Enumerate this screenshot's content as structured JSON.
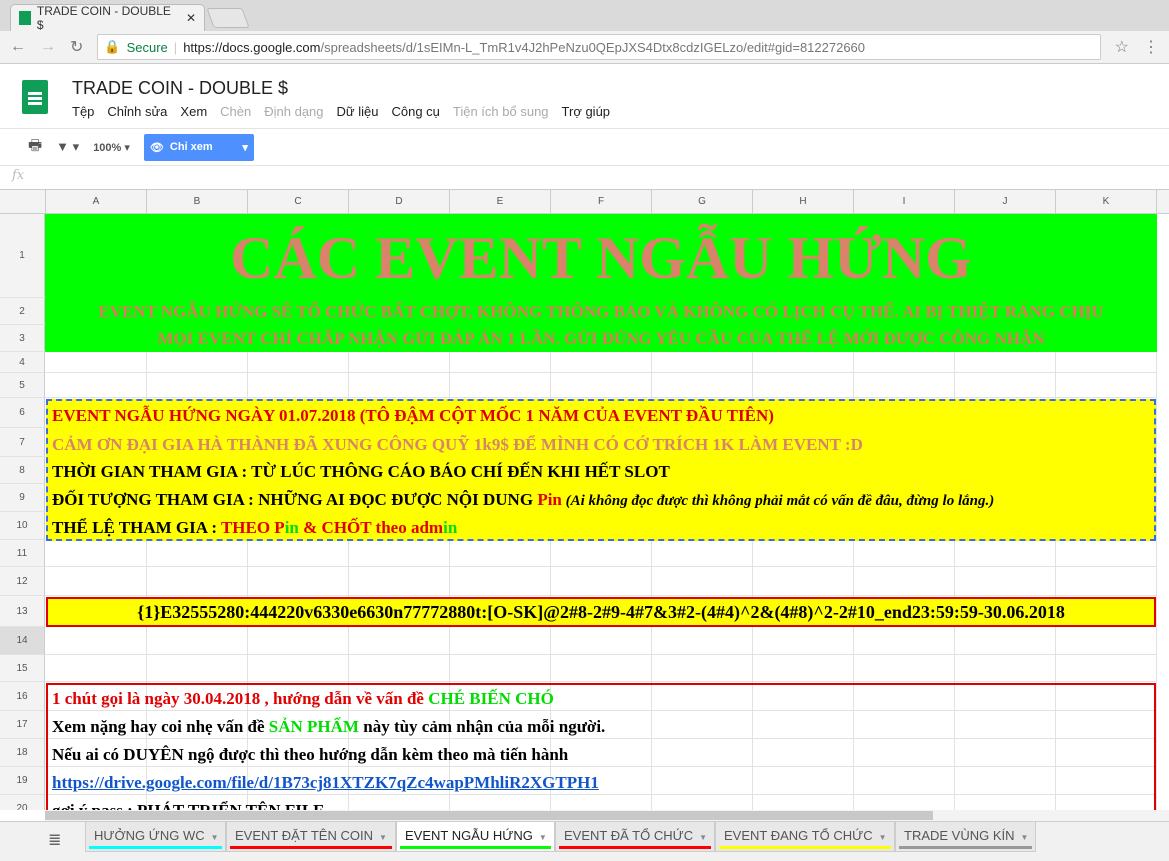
{
  "browser": {
    "tab_title": "TRADE COIN - DOUBLE $",
    "secure": "Secure",
    "url_host": "https://docs.google.com",
    "url_path": "/spreadsheets/d/1sEIMn-L_TmR1v4J2hPeNzu0QEpJXS4Dtx8cdzIGELzo/edit#gid=812272660"
  },
  "doc": {
    "title": "TRADE COIN - DOUBLE $",
    "menu": [
      "Tệp",
      "Chỉnh sửa",
      "Xem",
      "Chèn",
      "Định dạng",
      "Dữ liệu",
      "Công cụ",
      "Tiện ích bổ sung",
      "Trợ giúp"
    ]
  },
  "toolbar": {
    "zoom": "100%",
    "view_only": "Chỉ xem"
  },
  "formula_bar": {
    "fx": "fx"
  },
  "columns": [
    "A",
    "B",
    "C",
    "D",
    "E",
    "F",
    "G",
    "H",
    "I",
    "J",
    "K"
  ],
  "rows": [
    "1",
    "2",
    "3",
    "4",
    "5",
    "6",
    "7",
    "8",
    "9",
    "10",
    "11",
    "12",
    "13",
    "14",
    "15",
    "16",
    "17",
    "18",
    "19",
    "20"
  ],
  "banner": {
    "title": "CÁC EVENT NGẪU HỨNG",
    "line2": "EVENT NGẪU HỨNG SẼ TỔ CHỨC BẤT CHỢT, KHÔNG THÔNG BÁO VÀ KHÔNG CÓ LỊCH CỤ THỂ. AI BỊ THIỆT RÁNG CHỊU",
    "line3": "MỌI EVENT CHỈ CHẤP NHẬN GỬI ĐÁP ÁN 1 LẦN. GỬI ĐÚNG YÊU CẦU CỦA THỂ LỆ MỚI ĐƯỢC CÔNG NHẬN"
  },
  "event": {
    "r6": "EVENT NGẪU HỨNG NGÀY 01.07.2018 (TÔ ĐẬM CỘT MỐC 1 NĂM CỦA EVENT ĐẦU TIÊN)",
    "r7": "CẢM ƠN ĐẠI GIA HÀ THÀNH ĐÃ XUNG CÔNG QUỸ 1k9$ ĐỂ MÌNH CÓ CỚ TRÍCH 1K LÀM EVENT :D",
    "r8": "THỜI GIAN THAM GIA : TỪ LÚC THÔNG CÁO BÁO CHÍ ĐẾN KHI HẾT SLOT",
    "r9a": "ĐỐI TƯỢNG THAM GIA : NHỮNG AI ĐỌC ĐƯỢC NỘI DUNG ",
    "r9b": "Pin",
    "r9c": " (Ai không đọc được thì không phải mắt có vấn đề đâu, đừng lo lắng.)",
    "r10a": "THỂ LỆ THAM GIA : ",
    "r10b": "THEO P",
    "r10c": "in",
    "r10d": " & CHỐT theo adm",
    "r10e": "in"
  },
  "code": "{1}E32555280:444220v6330e6630n77772880t:[O-SK]@2#8-2#9-4#7&3#2-(4#4)^2&(4#8)^2-2#10_end23:59:59-30.06.2018",
  "guide": {
    "r16a": "1 chút gọi là ngày 30.04.2018 , hướng dẫn về vấn đề ",
    "r16b": "CHÉ BIẾN CHÓ",
    "r17a": "Xem nặng hay coi nhẹ vấn đề ",
    "r17b": "SẢN PHẨM",
    "r17c": " này tùy cảm nhận của mỗi người.",
    "r18": "Nếu ai có DUYÊN ngộ được thì theo hướng dẫn kèm theo mà tiến hành",
    "r19": "https://drive.google.com/file/d/1B73cj81XTZK7qZc4wapPMhliR2XGTPH1",
    "r20": "gợi ý pass : PHÁT TRIỂN TÊN FILE"
  },
  "sheets": [
    {
      "label": "HƯỞNG ỨNG WC",
      "color": "#00ffff"
    },
    {
      "label": "EVENT ĐẶT TÊN COIN",
      "color": "#ff0000"
    },
    {
      "label": "EVENT NGẪU HỨNG",
      "color": "#00ff00"
    },
    {
      "label": "EVENT ĐÃ TỔ CHỨC",
      "color": "#ff0000"
    },
    {
      "label": "EVENT ĐANG TỔ CHỨC",
      "color": "#ffff00"
    },
    {
      "label": "TRADE VÙNG KÍN",
      "color": "#999999"
    }
  ]
}
